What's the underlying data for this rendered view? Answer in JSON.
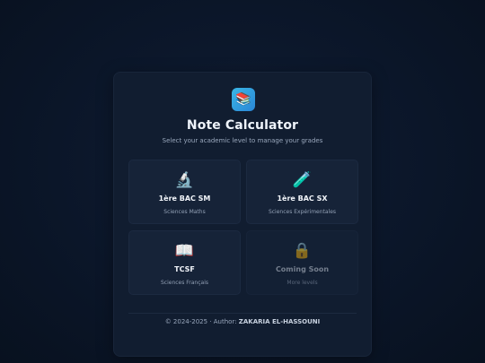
{
  "app": {
    "logo_icon": "books-icon",
    "logo_glyph": "📚",
    "title": "Note Calculator",
    "subtitle": "Select your academic level to manage your grades"
  },
  "levels": [
    {
      "icon": "microscope-icon",
      "glyph": "🔬",
      "name": "1ère BAC SM",
      "description": "Sciences Maths",
      "enabled": true
    },
    {
      "icon": "test-tube-icon",
      "glyph": "🧪",
      "name": "1ère BAC SX",
      "description": "Sciences Expérimentales",
      "enabled": true
    },
    {
      "icon": "open-book-icon",
      "glyph": "📖",
      "name": "TCSF",
      "description": "Sciences Français",
      "enabled": true
    },
    {
      "icon": "lock-icon",
      "glyph": "🔒",
      "name": "Coming Soon",
      "description": "More levels",
      "enabled": false
    }
  ],
  "footer": {
    "prefix": "© 2024-2025 · Author: ",
    "author": "ZAKARIA EL-HASSOUNI"
  },
  "colors": {
    "background": "#0a1628",
    "card": "#111d30",
    "tile": "#162338",
    "accent": "#3ab6e6"
  }
}
